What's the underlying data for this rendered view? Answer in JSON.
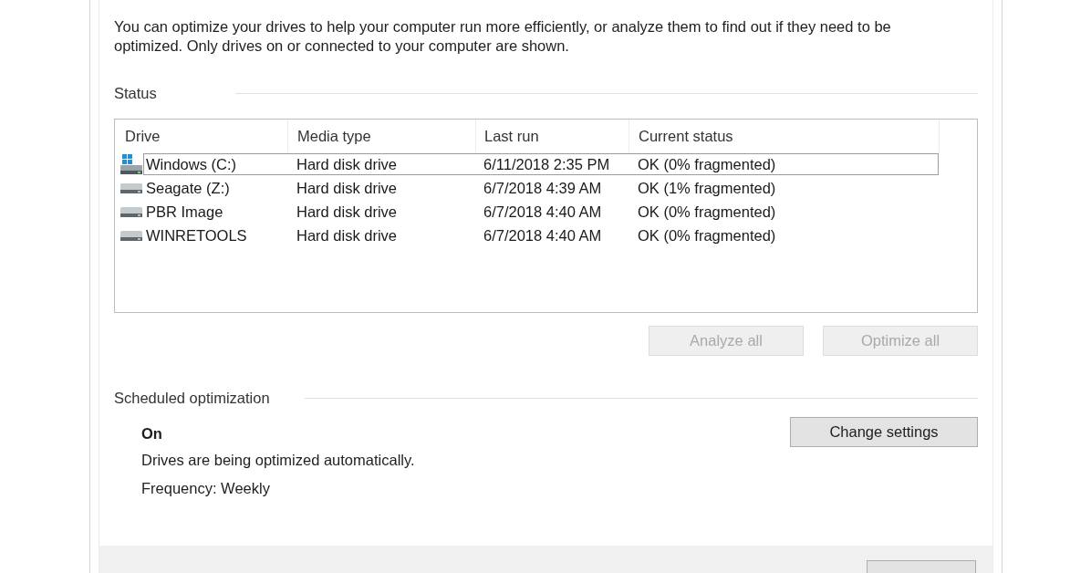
{
  "description": "You can optimize your drives to help your computer run more efficiently, or analyze them to find out if they need to be optimized. Only drives on or connected to your computer are shown.",
  "status_section": {
    "heading": "Status",
    "table": {
      "columns": [
        "Drive",
        "Media type",
        "Last run",
        "Current status"
      ],
      "rows": [
        {
          "kind": "system",
          "drive": "Windows (C:)",
          "media_type": "Hard disk drive",
          "last_run": "6/11/2018 2:35 PM",
          "current_status": "OK (0% fragmented)",
          "selected": true
        },
        {
          "kind": "disk",
          "drive": "Seagate (Z:)",
          "media_type": "Hard disk drive",
          "last_run": "6/7/2018 4:39 AM",
          "current_status": "OK (1% fragmented)",
          "selected": false
        },
        {
          "kind": "disk",
          "drive": "PBR Image",
          "media_type": "Hard disk drive",
          "last_run": "6/7/2018 4:40 AM",
          "current_status": "OK (0% fragmented)",
          "selected": false
        },
        {
          "kind": "disk",
          "drive": "WINRETOOLS",
          "media_type": "Hard disk drive",
          "last_run": "6/7/2018 4:40 AM",
          "current_status": "OK (0% fragmented)",
          "selected": false
        }
      ]
    },
    "buttons": [
      {
        "label": "Analyze all",
        "disabled": true
      },
      {
        "label": "Optimize all",
        "disabled": true
      }
    ]
  },
  "scheduled_optimization": {
    "heading": "Scheduled optimization",
    "status": "On",
    "description": "Drives are being optimized automatically.",
    "frequency": "Frequency: Weekly",
    "button": {
      "label": "Change settings",
      "disabled": false
    }
  }
}
